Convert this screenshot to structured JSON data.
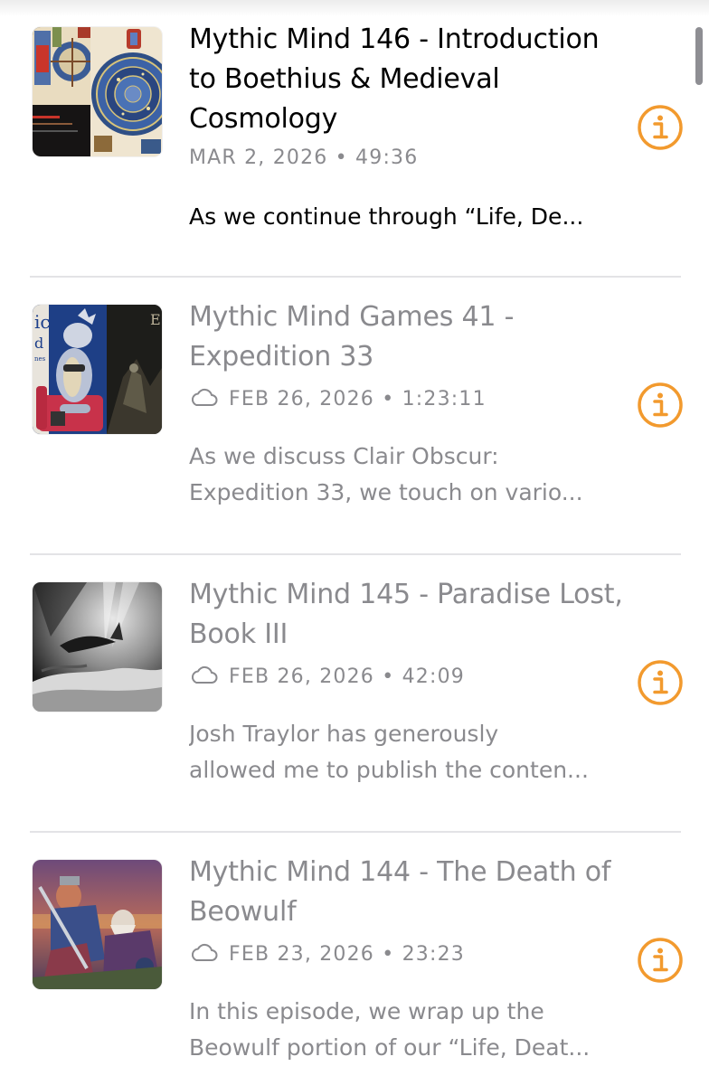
{
  "accent_color": "#f29a2e",
  "icons": {
    "info": "info-circle-icon",
    "cloud": "cloud-icon"
  },
  "episodes": [
    {
      "title": "Mythic Mind 146 - Introduction to Boethius & Medieval Cosmology",
      "date": "MAR 2, 2026",
      "duration": "49:36",
      "meta": "MAR 2, 2026 • 49:36",
      "description_lines": [
        "As we continue through “Life, De..."
      ],
      "played": false,
      "downloaded_to_cloud": false
    },
    {
      "title": "Mythic Mind Games 41 - Expedition 33",
      "date": "FEB 26, 2026",
      "duration": "1:23:11",
      "meta": "FEB 26, 2026 • 1:23:11",
      "description_lines": [
        "As we discuss Clair Obscur:",
        "Expedition 33, we touch on vario..."
      ],
      "played": true,
      "downloaded_to_cloud": true
    },
    {
      "title": "Mythic Mind 145 - Paradise Lost, Book III",
      "date": "FEB 26, 2026",
      "duration": "42:09",
      "meta": "FEB 26, 2026 • 42:09",
      "description_lines": [
        "Josh Traylor has generously",
        "allowed me to publish the conten..."
      ],
      "played": true,
      "downloaded_to_cloud": true
    },
    {
      "title": "Mythic Mind 144 - The Death of Beowulf",
      "date": "FEB 23, 2026",
      "duration": "23:23",
      "meta": "FEB 23, 2026 • 23:23",
      "description_lines": [
        "In this episode, we wrap up the",
        "Beowulf portion of our “Life, Deat..."
      ],
      "played": true,
      "downloaded_to_cloud": true
    }
  ]
}
